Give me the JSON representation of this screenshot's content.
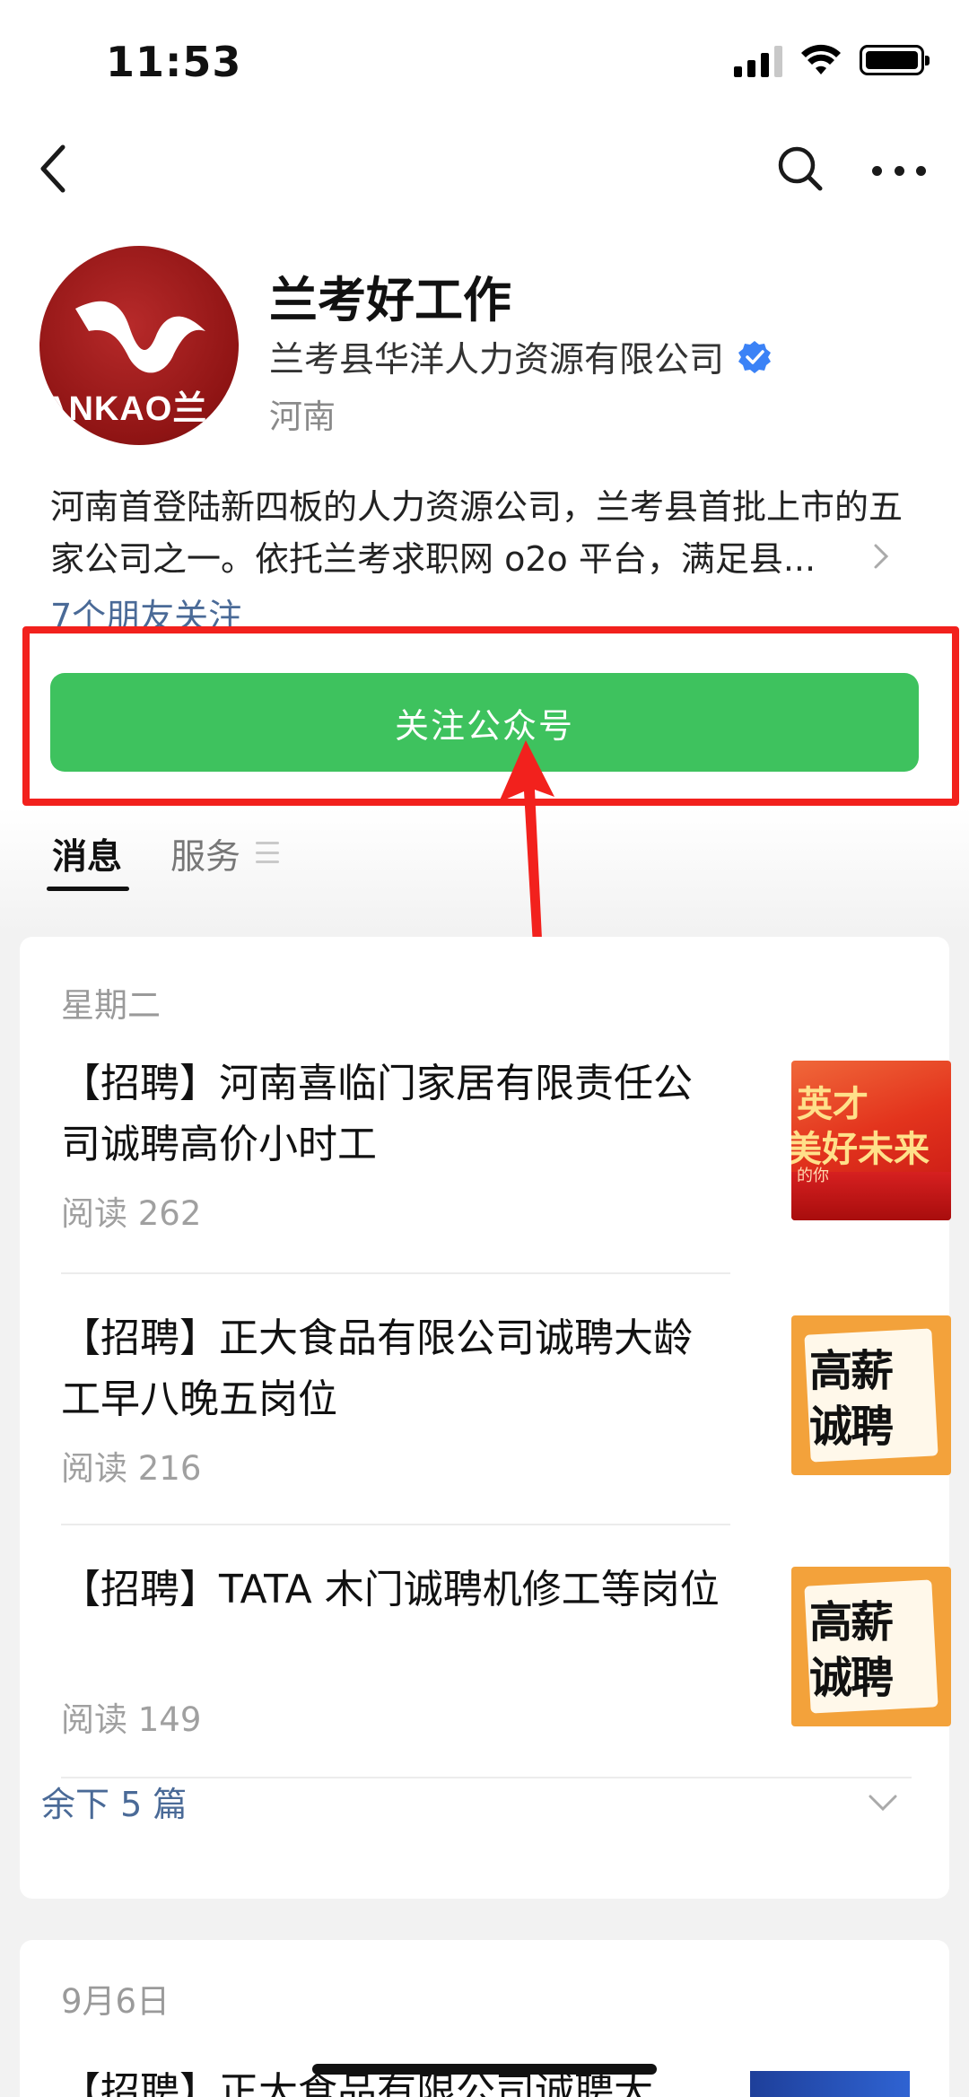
{
  "status_bar": {
    "time": "11:53"
  },
  "profile": {
    "avatar_brand": "ANKAO兰",
    "name": "兰考好工作",
    "company": "兰考县华洋人力资源有限公司",
    "region": "河南",
    "description": "河南首登陆新四板的人力资源公司，兰考县首批上市的五家公司之一。依托兰考求职网 o2o 平台，满足县...",
    "friends_following": "7个朋友关注"
  },
  "follow_button": {
    "label": "关注公众号"
  },
  "tabs": [
    {
      "label": "消息",
      "active": true
    },
    {
      "label": "服务",
      "active": false
    }
  ],
  "feed": {
    "groups": [
      {
        "date": "星期二",
        "articles": [
          {
            "title": "【招聘】河南喜临门家居有限责任公司诚聘高价小时工",
            "reads": "阅读 262",
            "thumb": {
              "style": "red",
              "line1": "英才",
              "line2": "美好未来",
              "line3": "的你"
            }
          },
          {
            "title": "【招聘】正大食品有限公司诚聘大龄工早八晚五岗位",
            "reads": "阅读 216",
            "thumb": {
              "style": "orange",
              "line1": "高薪",
              "line2": "诚聘"
            }
          },
          {
            "title": "【招聘】TATA 木门诚聘机修工等岗位",
            "reads": "阅读 149",
            "thumb": {
              "style": "orange",
              "line1": "高薪",
              "line2": "诚聘"
            }
          }
        ],
        "remaining": "余下 5 篇"
      },
      {
        "date": "9月6日",
        "articles": [
          {
            "title": "【招聘】正大食品有限公司诚聘大"
          }
        ]
      }
    ]
  },
  "colors": {
    "accent_green": "#3ec25e",
    "highlight_red": "#f2211d",
    "link_blue": "#4a6a97",
    "verified_blue": "#3b82f6"
  },
  "icons": [
    "back-icon",
    "search-icon",
    "more-icon",
    "verified-icon",
    "chevron-right-icon",
    "menu-icon",
    "chevron-down-icon",
    "arrow-annotation"
  ]
}
